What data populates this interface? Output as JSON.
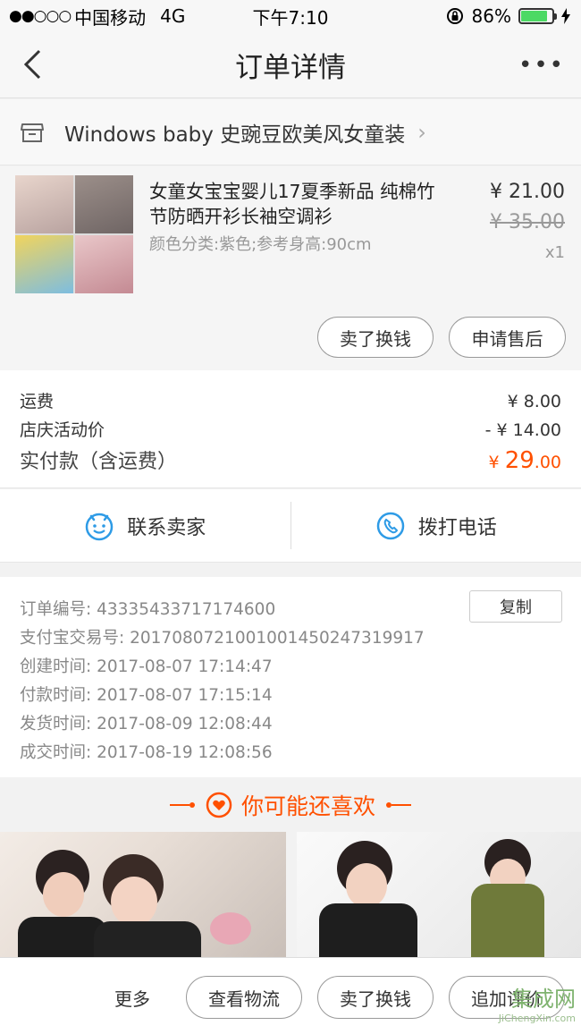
{
  "status_bar": {
    "signal": "●●○○○",
    "carrier": "中国移动",
    "network": "4G",
    "time": "下午7:10",
    "battery_percent": "86%",
    "battery_level": 0.86
  },
  "nav": {
    "title": "订单详情",
    "back_icon": "chevron-left-icon",
    "more_label": "•••"
  },
  "shop": {
    "name": "Windows baby 史豌豆欧美风女童装",
    "chevron": "›"
  },
  "item": {
    "title": "女童女宝宝婴儿17夏季新品 纯棉竹节防晒开衫长袖空调衫",
    "sku": "颜色分类:紫色;参考身高:90cm",
    "price": "¥ 21.00",
    "original_price": "¥ 35.00",
    "quantity": "x1",
    "actions": [
      "卖了换钱",
      "申请售后"
    ]
  },
  "fees": {
    "shipping_label": "运费",
    "shipping_value": "¥ 8.00",
    "promo_label": "店庆活动价",
    "promo_value": "- ¥ 14.00",
    "total_label": "实付款（含运费）",
    "total_currency": "¥",
    "total_int": "29",
    "total_dec": ".00"
  },
  "contact": {
    "seller_label": "联系卖家",
    "phone_label": "拨打电话"
  },
  "order_info": {
    "order_no": "订单编号:   43335433717174600",
    "alipay_no": "支付宝交易号:   2017080721001001450247319917",
    "created": "创建时间:   2017-08-07 17:14:47",
    "paid": "付款时间:   2017-08-07 17:15:14",
    "shipped": "发货时间:   2017-08-09 12:08:44",
    "completed": "成交时间:   2017-08-19 12:08:56",
    "copy_label": "复制"
  },
  "recommend": {
    "title": "你可能还喜欢"
  },
  "bottom_bar": {
    "more": "更多",
    "buttons": [
      "查看物流",
      "卖了换钱",
      "追加评价"
    ]
  },
  "watermark": {
    "logo": "集成网",
    "url": "JiChengXin.com"
  },
  "colors": {
    "accent": "#ff5000",
    "contact_blue": "#2e9be6"
  }
}
